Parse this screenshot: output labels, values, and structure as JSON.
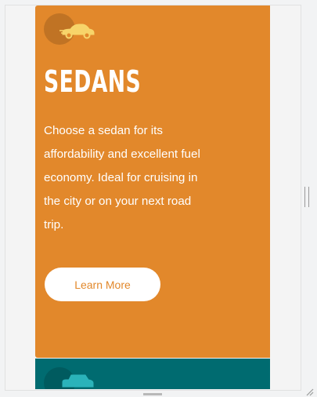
{
  "colors": {
    "card1_background": "#e2882b",
    "card1_icon": "#f7d46a",
    "card1_button_text": "#e2882b",
    "card2_background": "#006b70",
    "card2_icon": "#2bb3ba"
  },
  "card1": {
    "icon": "sedan-car-icon",
    "title": "SEDANS",
    "description": "Choose a sedan for its affordability and excellent fuel economy. Ideal for cruising in the city or on your next road trip.",
    "button_label": "Learn More"
  },
  "card2": {
    "icon": "suv-car-icon"
  }
}
